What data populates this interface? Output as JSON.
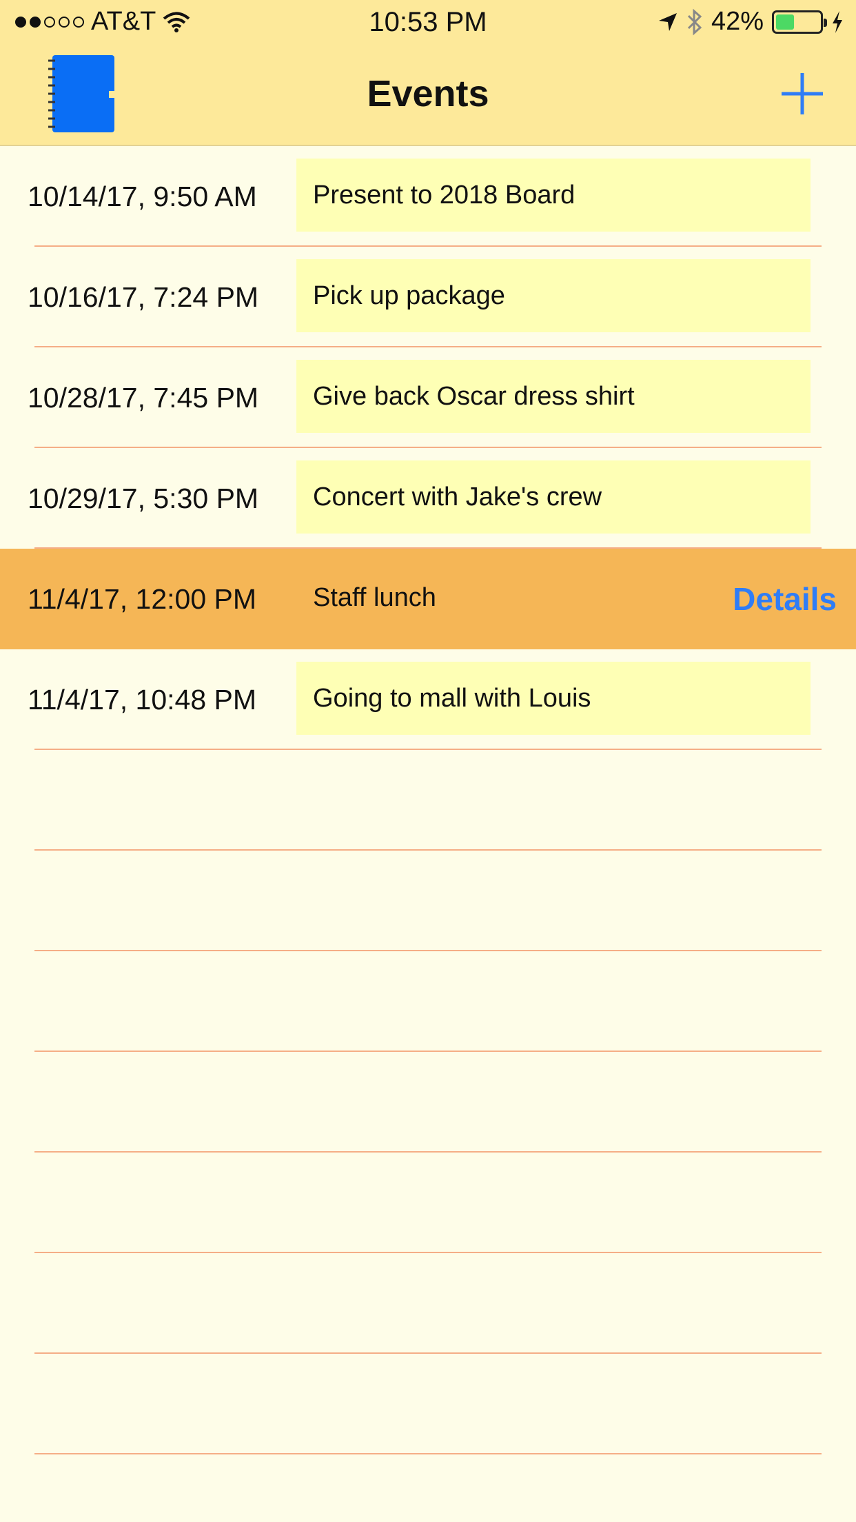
{
  "status_bar": {
    "carrier": "AT&T",
    "time": "10:53 PM",
    "battery": "42%",
    "battery_level": 0.42
  },
  "nav": {
    "title": "Events",
    "left_icon": "notebook-icon",
    "right_icon": "plus-icon"
  },
  "events": [
    {
      "date": "10/14/17, 9:50 AM",
      "title": "Present to 2018 Board"
    },
    {
      "date": "10/16/17, 7:24 PM",
      "title": "Pick up package"
    },
    {
      "date": "10/28/17, 7:45 PM",
      "title": "Give back Oscar dress shirt"
    },
    {
      "date": "10/29/17, 5:30 PM",
      "title": "Concert with Jake's crew"
    },
    {
      "date": "11/4/17, 12:00 PM",
      "title": "Staff lunch",
      "action": "Details"
    },
    {
      "date": "11/4/17, 10:48 PM",
      "title": "Going to mall with Louis"
    }
  ],
  "colors": {
    "bar_bg": "#fde99a",
    "page_bg": "#fefde8",
    "note_bg": "#feffb5",
    "selected_row": "#f5b656",
    "separator": "#f5ae86",
    "accent": "#2f7df6"
  }
}
